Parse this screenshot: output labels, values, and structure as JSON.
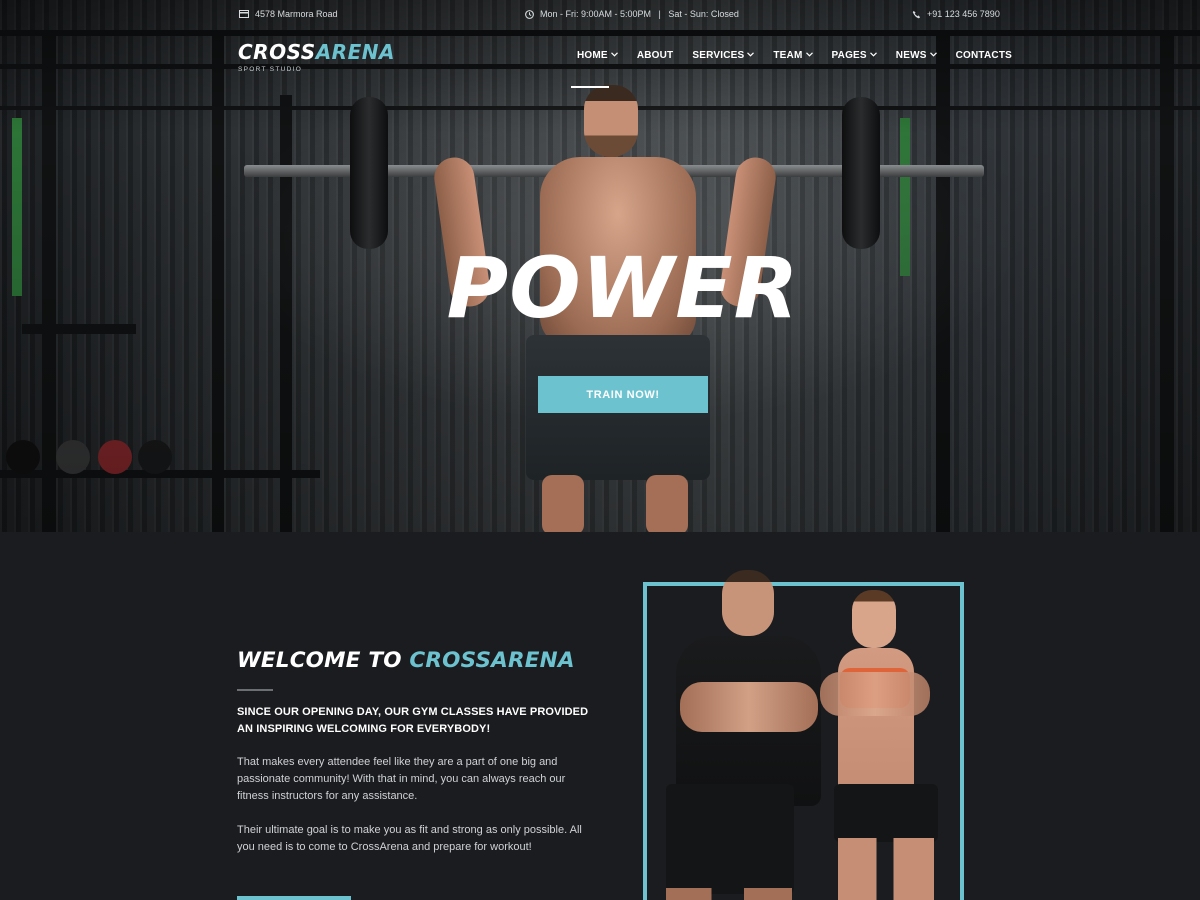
{
  "topbar": {
    "address": "4578 Marmora Road",
    "hours": "Mon - Fri: 9:00AM - 5:00PM   |   Sat - Sun: Closed",
    "phone": "+91 123 456 7890"
  },
  "brand": {
    "name_part1": "CROSS",
    "name_part2": "ARENA",
    "tagline": "SPORT STUDIO"
  },
  "nav": {
    "items": [
      {
        "label": "HOME",
        "has_dropdown": true,
        "active": true
      },
      {
        "label": "ABOUT",
        "has_dropdown": false
      },
      {
        "label": "SERVICES",
        "has_dropdown": true
      },
      {
        "label": "TEAM",
        "has_dropdown": true
      },
      {
        "label": "PAGES",
        "has_dropdown": true
      },
      {
        "label": "NEWS",
        "has_dropdown": true
      },
      {
        "label": "CONTACTS",
        "has_dropdown": false
      }
    ]
  },
  "hero": {
    "title": "POWER",
    "cta_label": "TRAIN NOW!"
  },
  "welcome": {
    "title_part1": "WELCOME TO ",
    "title_part2": "CROSSARENA",
    "lead": "SINCE OUR OPENING DAY, OUR GYM CLASSES HAVE PROVIDED AN INSPIRING WELCOMING FOR EVERYBODY!",
    "paragraph1": "That makes every attendee feel like they are a part of one big and passionate community! With that in mind, you can always reach our fitness instructors for any assistance.",
    "paragraph2": "Their ultimate goal is to make you as fit and strong as only possible. All you need is to come to CrossArena and prepare for workout!"
  },
  "icons": {
    "address": "card-icon",
    "hours": "clock-icon",
    "phone": "phone-icon",
    "dropdown": "chevron-down-icon"
  },
  "colors": {
    "accent": "#6cc3cf",
    "background": "#1b1c1f",
    "text": "#ffffff"
  }
}
